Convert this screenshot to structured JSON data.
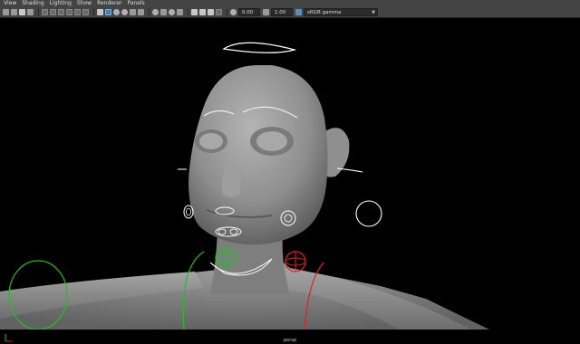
{
  "menu": {
    "items": [
      "View",
      "Shading",
      "Lighting",
      "Show",
      "Renderer",
      "Panels"
    ]
  },
  "toolbar": {
    "exposure_value": "0.00",
    "gamma_value": "1.00",
    "color_space": "sRGB gamma",
    "icons": [
      "select-camera-icon",
      "camera-attributes-icon",
      "bookmark-icon",
      "image-plane-icon",
      "grid-icon",
      "film-gate-icon",
      "resolution-gate-icon",
      "gate-mask-icon",
      "field-chart-icon",
      "safe-action-icon",
      "safe-title-icon",
      "wireframe-icon",
      "smooth-shade-icon",
      "default-material-icon",
      "textured-icon",
      "use-lights-icon",
      "shadows-icon",
      "ambient-occlusion-icon",
      "motion-blur-icon",
      "antialiasing-icon",
      "depth-of-field-icon",
      "isolate-select-icon",
      "xray-icon",
      "xray-joints-icon",
      "backface-culling-icon",
      "exposure-icon",
      "gamma-icon",
      "color-management-icon"
    ]
  },
  "viewport": {
    "camera_label": "persp",
    "background": "#000000"
  },
  "colors": {
    "toolbar_bg": "#444444",
    "active_icon": "#3e7fb8",
    "mesh": "#8a8a8a",
    "ctrl_white": "#ffffff",
    "ctrl_green": "#22c022",
    "ctrl_red": "#dd2222"
  }
}
